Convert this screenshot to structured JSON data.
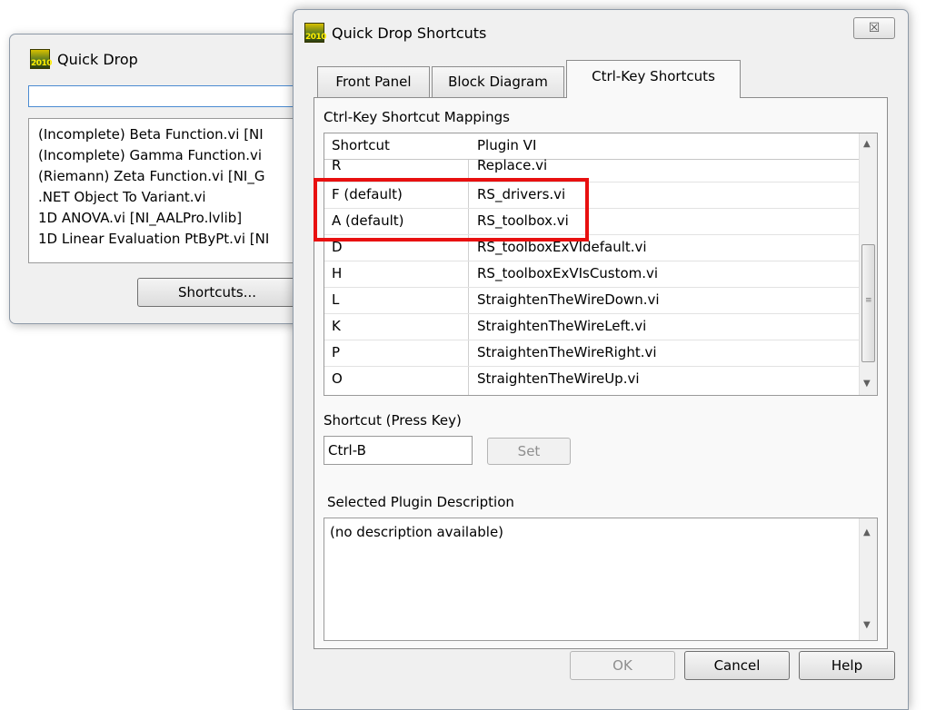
{
  "quick_drop": {
    "title": "Quick Drop",
    "icon_text": "2010",
    "search_value": "",
    "items": [
      "(Incomplete) Beta Function.vi [NI",
      "(Incomplete) Gamma Function.vi",
      "(Riemann) Zeta Function.vi [NI_G",
      ".NET Object To Variant.vi",
      "1D ANOVA.vi [NI_AALPro.lvlib]",
      "1D Linear Evaluation PtByPt.vi [NI"
    ],
    "shortcuts_button": "Shortcuts..."
  },
  "dialog": {
    "title": "Quick Drop Shortcuts",
    "icon_text": "2010",
    "close_glyph": "☒",
    "tabs": [
      "Front Panel",
      "Block Diagram",
      "Ctrl-Key Shortcuts"
    ],
    "mappings_label": "Ctrl-Key Shortcut Mappings",
    "columns": [
      "Shortcut",
      "Plugin VI"
    ],
    "rows": [
      {
        "shortcut": "R",
        "plugin": "Replace.vi"
      },
      {
        "shortcut": "F (default)",
        "plugin": "RS_drivers.vi"
      },
      {
        "shortcut": "A (default)",
        "plugin": "RS_toolbox.vi"
      },
      {
        "shortcut": "D",
        "plugin": "RS_toolboxExVIdefault.vi"
      },
      {
        "shortcut": "H",
        "plugin": "RS_toolboxExVIsCustom.vi"
      },
      {
        "shortcut": "L",
        "plugin": "StraightenTheWireDown.vi"
      },
      {
        "shortcut": "K",
        "plugin": "StraightenTheWireLeft.vi"
      },
      {
        "shortcut": "P",
        "plugin": "StraightenTheWireRight.vi"
      },
      {
        "shortcut": "O",
        "plugin": "StraightenTheWireUp.vi"
      }
    ],
    "press_key_label": "Shortcut (Press Key)",
    "press_key_value": "Ctrl-B",
    "set_button": "Set",
    "description_label": "Selected Plugin Description",
    "description_text": "(no description available)",
    "ok_button": "OK",
    "cancel_button": "Cancel",
    "help_button": "Help"
  },
  "colors": {
    "highlight_box": "#e81010",
    "focus_border": "#4b8bd1"
  },
  "icons": {
    "scroll_up": "▲",
    "scroll_down": "▼",
    "grip": "≡"
  }
}
